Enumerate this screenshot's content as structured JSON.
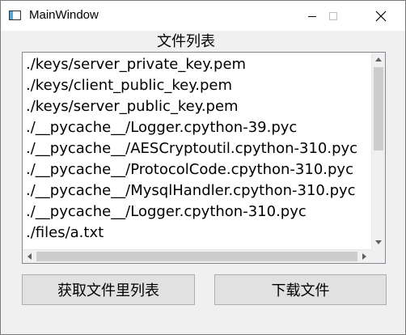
{
  "window": {
    "title": "MainWindow",
    "icon": "window-app-icon",
    "controls": [
      "minimize-icon",
      "maximize-icon",
      "close-icon"
    ]
  },
  "list": {
    "title": "文件列表",
    "items": [
      "./keys/server_private_key.pem",
      "./keys/client_public_key.pem",
      "./keys/server_public_key.pem",
      "./__pycache__/Logger.cpython-39.pyc",
      "./__pycache__/AESCryptoutil.cpython-310.pyc",
      "./__pycache__/ProtocolCode.cpython-310.pyc",
      "./__pycache__/MysqlHandler.cpython-310.pyc",
      "./__pycache__/Logger.cpython-310.pyc",
      "./files/a.txt"
    ]
  },
  "buttons": {
    "get_list": "获取文件里列表",
    "download": "下载文件"
  }
}
